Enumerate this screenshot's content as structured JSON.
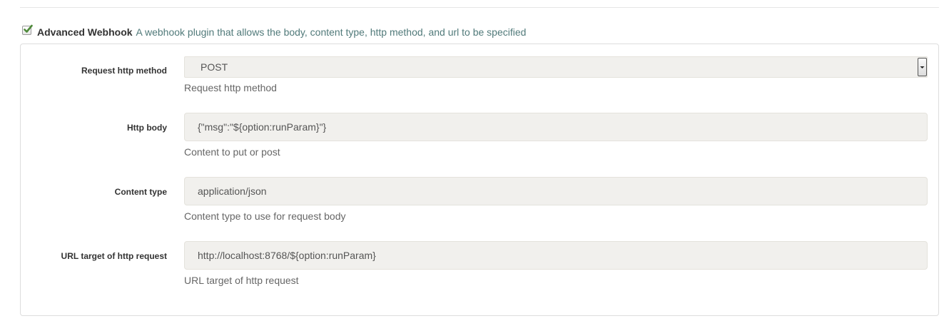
{
  "plugin": {
    "enabled": true,
    "title": "Advanced Webhook",
    "description": "A webhook plugin that allows the body, content type, http method, and url to be specified"
  },
  "fields": {
    "method": {
      "label": "Request http method",
      "value": "POST",
      "help": "Request http method"
    },
    "body": {
      "label": "Http body",
      "value": "{\"msg\":\"${option:runParam}\"}",
      "help": "Content to put or post"
    },
    "content_type": {
      "label": "Content type",
      "value": "application/json",
      "help": "Content type to use for request body"
    },
    "url": {
      "label": "URL target of http request",
      "value": "http://localhost:8768/${option:runParam}",
      "help": "URL target of http request"
    }
  },
  "icons": {
    "checkbox": "checkmark-icon",
    "select_arrow": "chevron-down-icon"
  },
  "colors": {
    "check": "#4e8a3a",
    "description": "#517a7a",
    "input_bg": "#f1f0ed"
  }
}
